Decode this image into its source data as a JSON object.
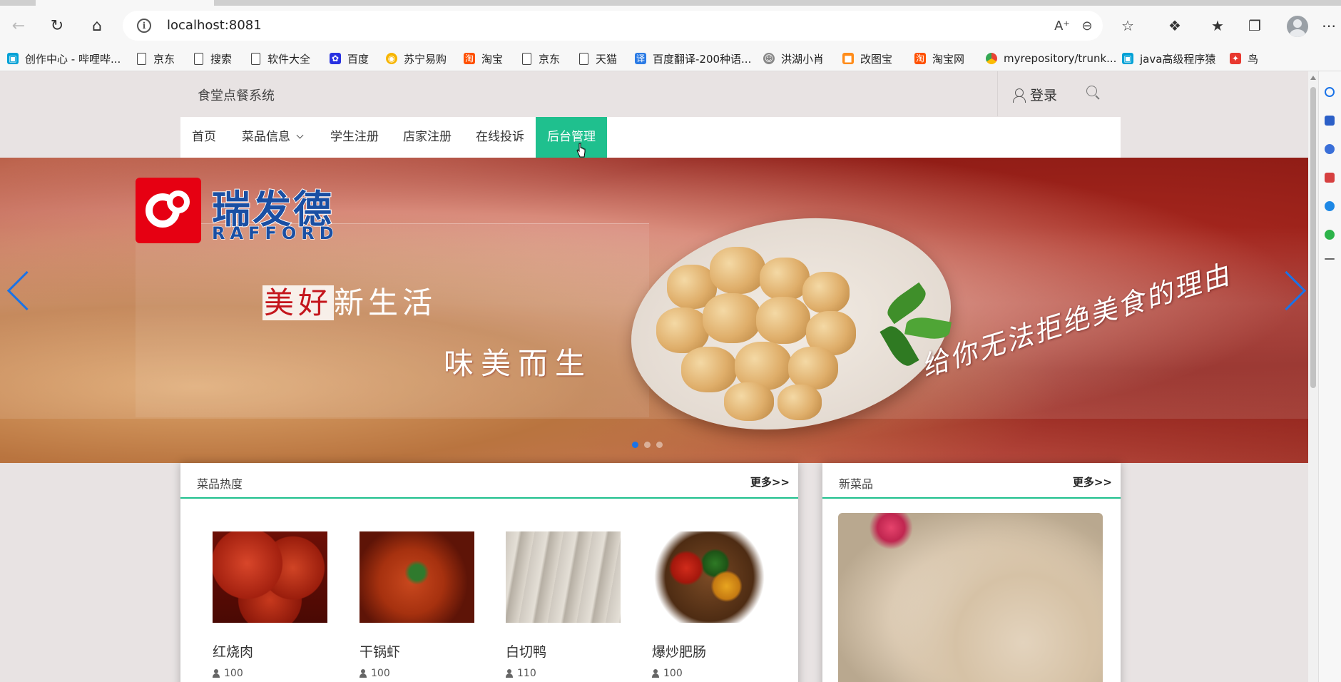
{
  "browser": {
    "url": "localhost:8081",
    "icons": [
      "back-icon",
      "refresh-icon",
      "home-icon",
      "info-icon",
      "read-aloud-icon",
      "zoom-out-icon",
      "favorite-add-icon",
      "extensions-icon",
      "favorites-icon",
      "collections-icon",
      "profile-icon",
      "more-icon"
    ]
  },
  "bookmarks": [
    {
      "label": "创作中心 - 哔哩哔...",
      "icon": "bilibili-icon"
    },
    {
      "label": "京东",
      "icon": "file-icon"
    },
    {
      "label": "搜索",
      "icon": "file-icon"
    },
    {
      "label": "软件大全",
      "icon": "file-icon"
    },
    {
      "label": "百度",
      "icon": "baidu-icon"
    },
    {
      "label": "苏宁易购",
      "icon": "suning-icon"
    },
    {
      "label": "淘宝",
      "icon": "taobao-icon"
    },
    {
      "label": "京东",
      "icon": "file-icon"
    },
    {
      "label": "天猫",
      "icon": "file-icon"
    },
    {
      "label": "百度翻译-200种语...",
      "icon": "baidu-translate-icon"
    },
    {
      "label": "洪湖小肖",
      "icon": "avatar-icon"
    },
    {
      "label": "改图宝",
      "icon": "gaitubao-icon"
    },
    {
      "label": "淘宝网",
      "icon": "taobao-icon"
    },
    {
      "label": "myrepository/trunk...",
      "icon": "chrome-icon"
    },
    {
      "label": "java高级程序猿",
      "icon": "bilibili-icon"
    },
    {
      "label": "鸟",
      "icon": "bird-icon"
    }
  ],
  "site": {
    "title": "食堂点餐系统",
    "login": "登录"
  },
  "nav": [
    {
      "label": "首页"
    },
    {
      "label": "菜品信息"
    },
    {
      "label": "学生注册"
    },
    {
      "label": "店家注册"
    },
    {
      "label": "在线投诉"
    },
    {
      "label": "后台管理"
    }
  ],
  "banner": {
    "brand_cn": "瑞发德",
    "brand_en": "RAFFORD",
    "slogan_red": "美好",
    "slogan_line1": "新生活",
    "slogan_line2": "味美而生",
    "slogan_line3": "给你无法拒绝美食的理由",
    "slide_count": 3,
    "active_slide": 1
  },
  "hot_panel": {
    "title": "菜品热度",
    "more": "更多>>",
    "dishes": [
      {
        "name": "红烧肉",
        "count": "100"
      },
      {
        "name": "干锅虾",
        "count": "100"
      },
      {
        "name": "白切鸭",
        "count": "110"
      },
      {
        "name": "爆炒肥肠",
        "count": "100"
      }
    ]
  },
  "new_panel": {
    "title": "新菜品",
    "more": "更多>>"
  },
  "colors": {
    "accent": "#1fc08e",
    "arrow": "#1a73e8",
    "logo_red": "#e60012",
    "logo_blue": "#1a4fa3"
  }
}
